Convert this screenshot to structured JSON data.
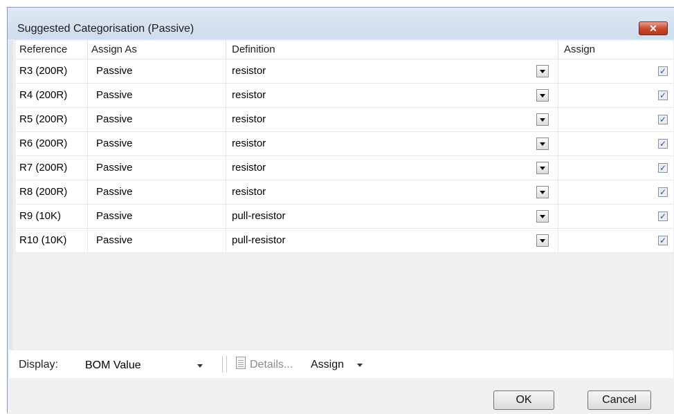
{
  "window": {
    "title": "Suggested Categorisation (Passive)",
    "close_glyph": "✕"
  },
  "grid": {
    "columns": [
      "Reference",
      "Assign As",
      "Definition",
      "Assign"
    ],
    "rows": [
      {
        "reference": "R3 (200R)",
        "assign_as": "Passive",
        "definition": "resistor",
        "assign": true
      },
      {
        "reference": "R4 (200R)",
        "assign_as": "Passive",
        "definition": "resistor",
        "assign": true
      },
      {
        "reference": "R5 (200R)",
        "assign_as": "Passive",
        "definition": "resistor",
        "assign": true
      },
      {
        "reference": "R6 (200R)",
        "assign_as": "Passive",
        "definition": "resistor",
        "assign": true
      },
      {
        "reference": "R7 (200R)",
        "assign_as": "Passive",
        "definition": "resistor",
        "assign": true
      },
      {
        "reference": "R8 (200R)",
        "assign_as": "Passive",
        "definition": "resistor",
        "assign": true
      },
      {
        "reference": "R9 (10K)",
        "assign_as": "Passive",
        "definition": "pull-resistor",
        "assign": true
      },
      {
        "reference": "R10 (10K)",
        "assign_as": "Passive",
        "definition": "pull-resistor",
        "assign": true
      }
    ]
  },
  "toolbar": {
    "display_label": "Display:",
    "display_value": "BOM Value",
    "details_label": "Details...",
    "assign_label": "Assign"
  },
  "buttons": {
    "ok": "OK",
    "cancel": "Cancel"
  },
  "icons": {
    "checkbox": "checkmark-icon",
    "details": "document-icon",
    "dropdown": "chevron-down-icon"
  },
  "colors": {
    "close_button": "#c9462c",
    "title_bar": "#dfe9f5",
    "check": "#2f4fa0"
  }
}
